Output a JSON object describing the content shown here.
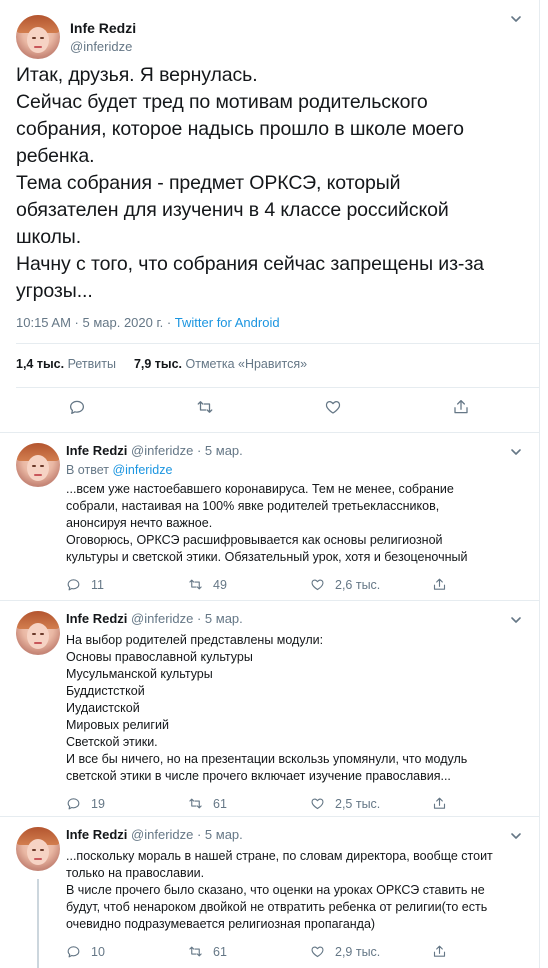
{
  "main_tweet": {
    "author_name": "Infe Redzi",
    "author_handle": "@inferidze",
    "lines": [
      "Итак, друзья. Я вернулась.",
      "Сейчас будет тред по мотивам родительского",
      "собрания, которое надысь прошло в школе моего",
      "ребенка.",
      "Тема собрания - предмет ОРКСЭ, который",
      "обязателен для изученич в 4 классе российской",
      "школы.",
      "Начну с того, что собрания сейчас запрещены из-за",
      "угрозы..."
    ],
    "timestamp": "10:15 AM · 5 мар. 2020 г. · ",
    "source": "Twitter for Android",
    "retweets_count": "1,4 тыс.",
    "retweets_label": "Ретвиты",
    "likes_count": "7,9 тыс.",
    "likes_label": "Отметка «Нравится»"
  },
  "replies": [
    {
      "name": "Infe Redzi",
      "handle_date": "@inferidze · 5 мар.",
      "in_reply_prefix": "В ответ ",
      "in_reply_handle": "@inferidze",
      "lines": [
        "...всем уже настоебавшего коронавируса. Тем не менее, собрание",
        "собрали, настаивая на 100% явке родителей третьеклассников,",
        "анонсируя нечто важное.",
        "Оговорюсь, ОРКСЭ расшифровывается как основы религиозной",
        "культуры и светской этики. Обязательный урок, хотя и безоценочный"
      ],
      "replies": "11",
      "retweets": "49",
      "likes": "2,6 тыс."
    },
    {
      "name": "Infe Redzi",
      "handle_date": "@inferidze · 5 мар.",
      "lines": [
        "На выбор родителей представлены модули:",
        "Основы православной культуры",
        "Мусульманской культуры",
        "Буддистсткой",
        "Иудаистской",
        "Мировых религий",
        "Светской этики.",
        "И все бы ничего, но на презентации вскользь упомянули, что модуль",
        "светской этики в числе прочего включает изучение православия..."
      ],
      "replies": "19",
      "retweets": "61",
      "likes": "2,5 тыс."
    },
    {
      "name": "Infe Redzi",
      "handle_date": "@inferidze · 5 мар.",
      "lines": [
        "...поскольку мораль в нашей стране, по словам директора, вообще стоит",
        "только на православии.",
        "В числе прочего было сказано, что оценки на уроках ОРКСЭ ставить не",
        "будут, чтоб ненароком двойкой не отвратить ребенка от религии(то есть",
        "очевидно подразумевается религиозная пропаганда)"
      ],
      "replies": "10",
      "retweets": "61",
      "likes": "2,9 тыс."
    }
  ],
  "icons": {
    "reply": "reply-icon",
    "retweet": "retweet-icon",
    "like": "heart-icon",
    "share": "share-icon",
    "more": "chevron-down-icon"
  },
  "colors": {
    "link": "#1b95e0",
    "secondary_text": "#657786",
    "border": "#e6ecf0"
  }
}
